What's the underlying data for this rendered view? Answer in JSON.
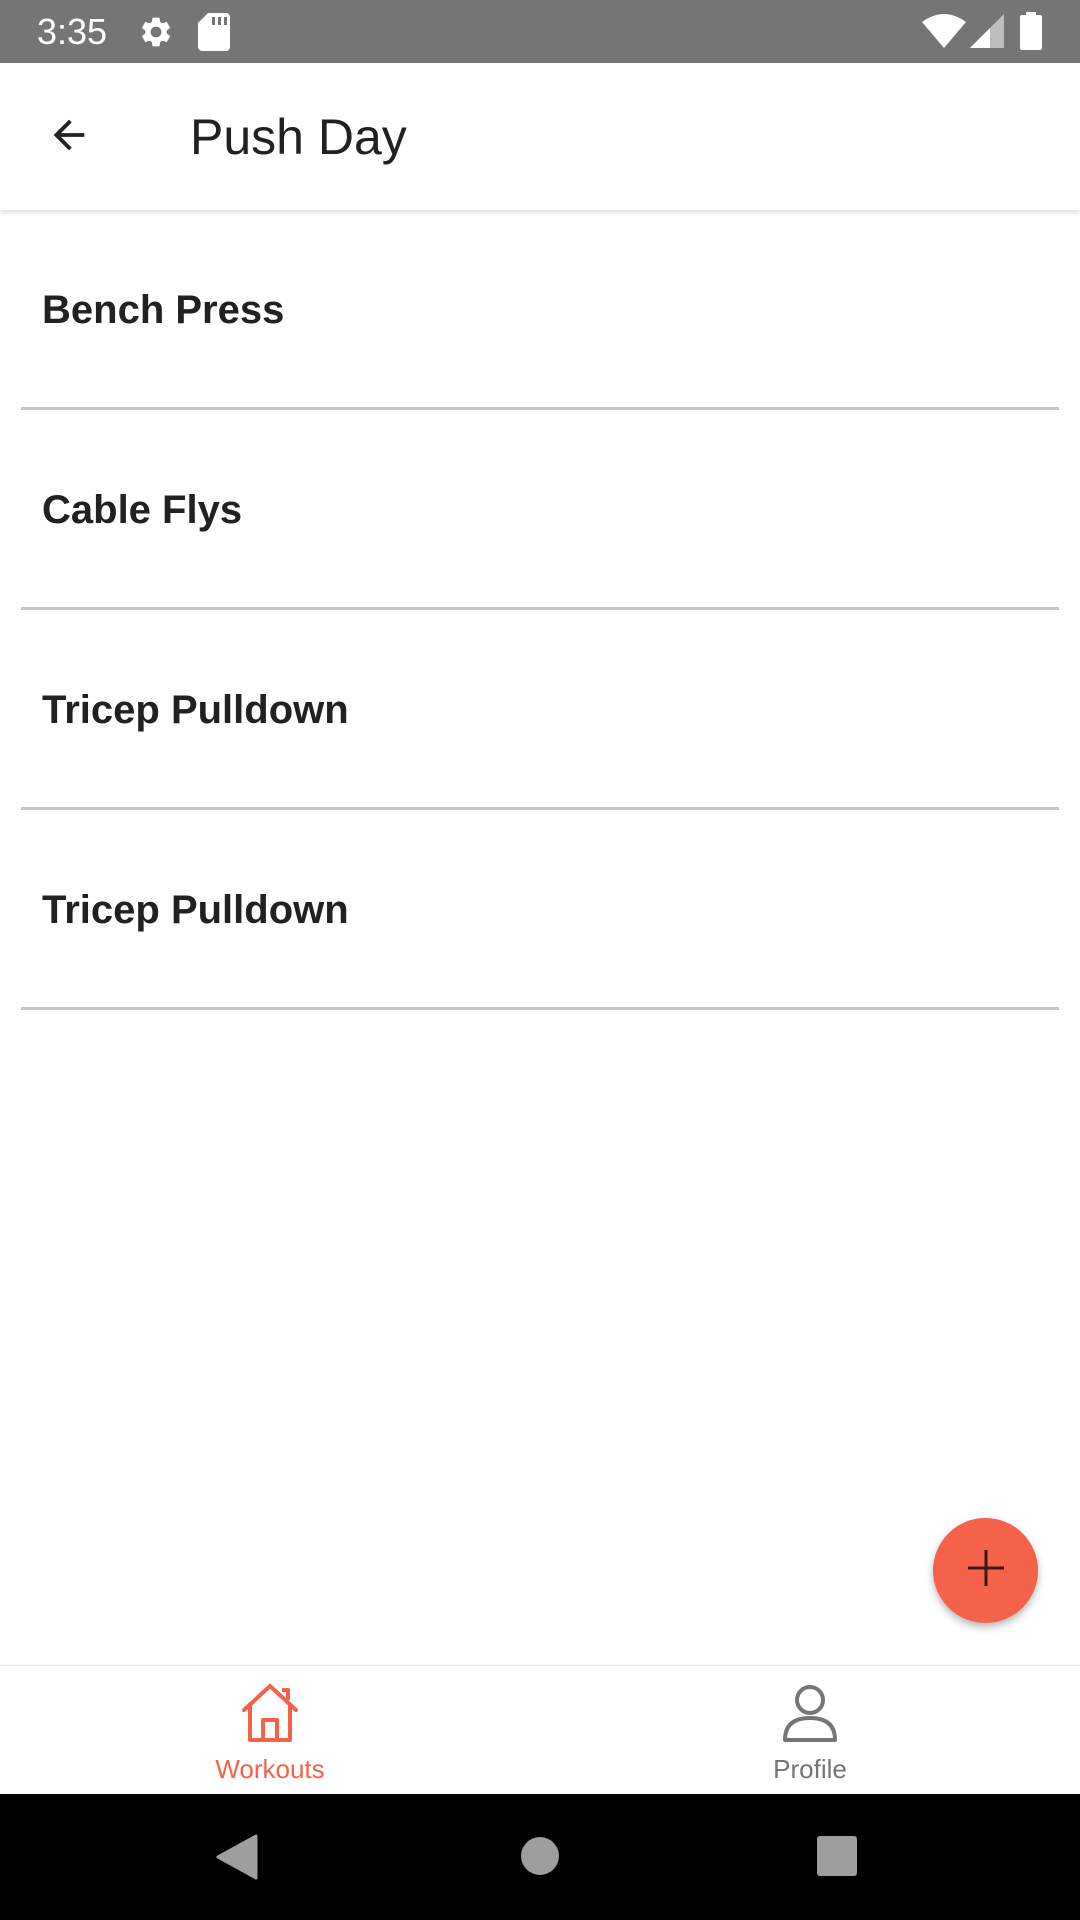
{
  "status_bar": {
    "time": "3:35",
    "icons": [
      "settings-icon",
      "sd-card-icon",
      "wifi-icon",
      "cell-signal-icon",
      "battery-icon"
    ]
  },
  "app_bar": {
    "title": "Push Day",
    "back_icon": "arrow-back-icon"
  },
  "exercises": [
    {
      "label": "Bench Press"
    },
    {
      "label": "Cable Flys"
    },
    {
      "label": "Tricep Pulldown"
    },
    {
      "label": "Tricep Pulldown"
    }
  ],
  "fab": {
    "icon": "plus-icon"
  },
  "bottom_nav": {
    "items": [
      {
        "label": "Workouts",
        "icon": "home-icon",
        "active": true
      },
      {
        "label": "Profile",
        "icon": "person-icon",
        "active": false
      }
    ]
  },
  "system_nav": {
    "icons": [
      "back-triangle-icon",
      "home-circle-icon",
      "recents-square-icon"
    ]
  },
  "colors": {
    "accent": "#f5624a",
    "status_bar": "#757575",
    "divider": "#c4c4c4",
    "text_primary": "#212121",
    "inactive": "#757575"
  }
}
